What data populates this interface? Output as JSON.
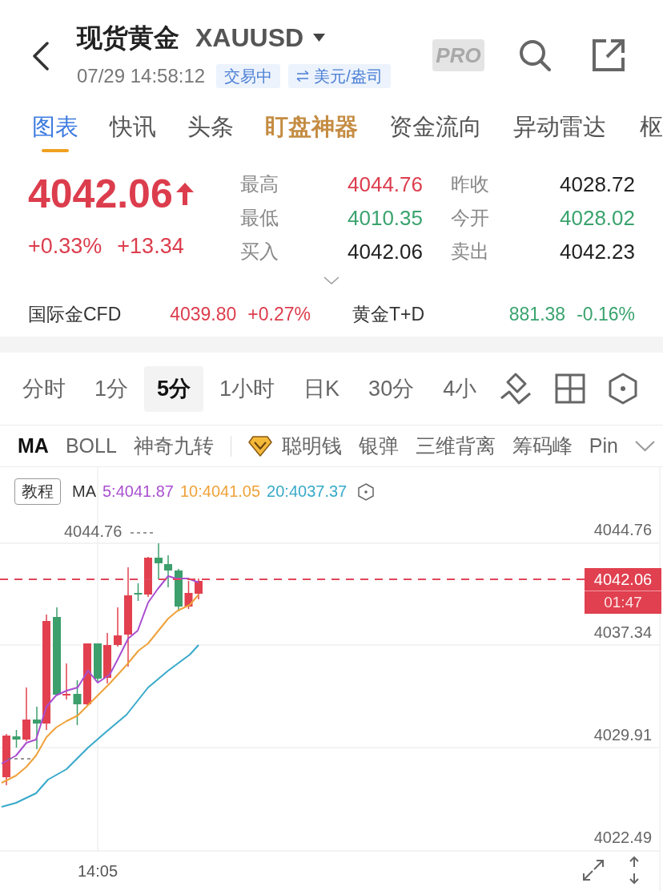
{
  "header": {
    "title": "现货黄金",
    "symbol": "XAUUSD",
    "datetime": "07/29 14:58:12",
    "market_status": "交易中",
    "unit": "美元/盎司",
    "pro_badge": "PRO"
  },
  "tabs": [
    {
      "label": "图表",
      "selected": true,
      "kind": "normal"
    },
    {
      "label": "快讯",
      "selected": false,
      "kind": "normal"
    },
    {
      "label": "头条",
      "selected": false,
      "kind": "normal"
    },
    {
      "label": "盯盘神器",
      "selected": false,
      "kind": "featured"
    },
    {
      "label": "资金流向",
      "selected": false,
      "kind": "normal"
    },
    {
      "label": "异动雷达",
      "selected": false,
      "kind": "normal"
    },
    {
      "label": "枢",
      "selected": false,
      "kind": "normal"
    }
  ],
  "quote": {
    "price": "4042.06",
    "rising": true,
    "change_percent": "+0.33%",
    "change": "+13.34"
  },
  "stats": [
    {
      "label": "最高",
      "value": "4044.76",
      "color": "#dc3d4d"
    },
    {
      "label": "昨收",
      "value": "4028.72",
      "color": "#222222"
    },
    {
      "label": "最低",
      "value": "4010.35",
      "color": "#3aa36e"
    },
    {
      "label": "今开",
      "value": "4028.02",
      "color": "#3aa36e"
    },
    {
      "label": "买入",
      "value": "4042.06",
      "color": "#222222"
    },
    {
      "label": "卖出",
      "value": "4042.23",
      "color": "#222222"
    }
  ],
  "related": [
    {
      "name": "国际金CFD",
      "price": "4039.80",
      "change": "+0.27%",
      "color": "#dc3d4d"
    },
    {
      "name": "黄金T+D",
      "price": "881.38",
      "change": "-0.16%",
      "color": "#3aa36e"
    }
  ],
  "periods": [
    {
      "label": "分时",
      "selected": false
    },
    {
      "label": "1分",
      "selected": false
    },
    {
      "label": "5分",
      "selected": true
    },
    {
      "label": "1小时",
      "selected": false
    },
    {
      "label": "日K",
      "selected": false
    },
    {
      "label": "30分",
      "selected": false
    },
    {
      "label": "4小",
      "selected": false
    }
  ],
  "indicators": [
    {
      "label": "MA",
      "selected": true
    },
    {
      "label": "BOLL",
      "selected": false
    },
    {
      "label": "神奇九转",
      "selected": false
    }
  ],
  "premium_indicators": [
    {
      "label": "聪明钱",
      "selected": false
    },
    {
      "label": "银弹",
      "selected": false
    },
    {
      "label": "三维背离",
      "selected": false
    },
    {
      "label": "筹码峰",
      "selected": false
    },
    {
      "label": "Pin",
      "selected": false
    }
  ],
  "legend": {
    "tutorial": "教程",
    "indicator": "MA",
    "values": [
      {
        "text": "5:4041.87",
        "color": "#a94fd0"
      },
      {
        "text": "10:4041.05",
        "color": "#efa23a"
      },
      {
        "text": "20:4037.37",
        "color": "#38a9c9"
      }
    ]
  },
  "chart": {
    "y_labels": [
      "4044.76",
      "4037.34",
      "4029.91",
      "4022.49"
    ],
    "high_label": "4044.76",
    "current_price": "4042.06",
    "countdown": "01:47",
    "x_labels": [
      "14:05"
    ]
  }
}
